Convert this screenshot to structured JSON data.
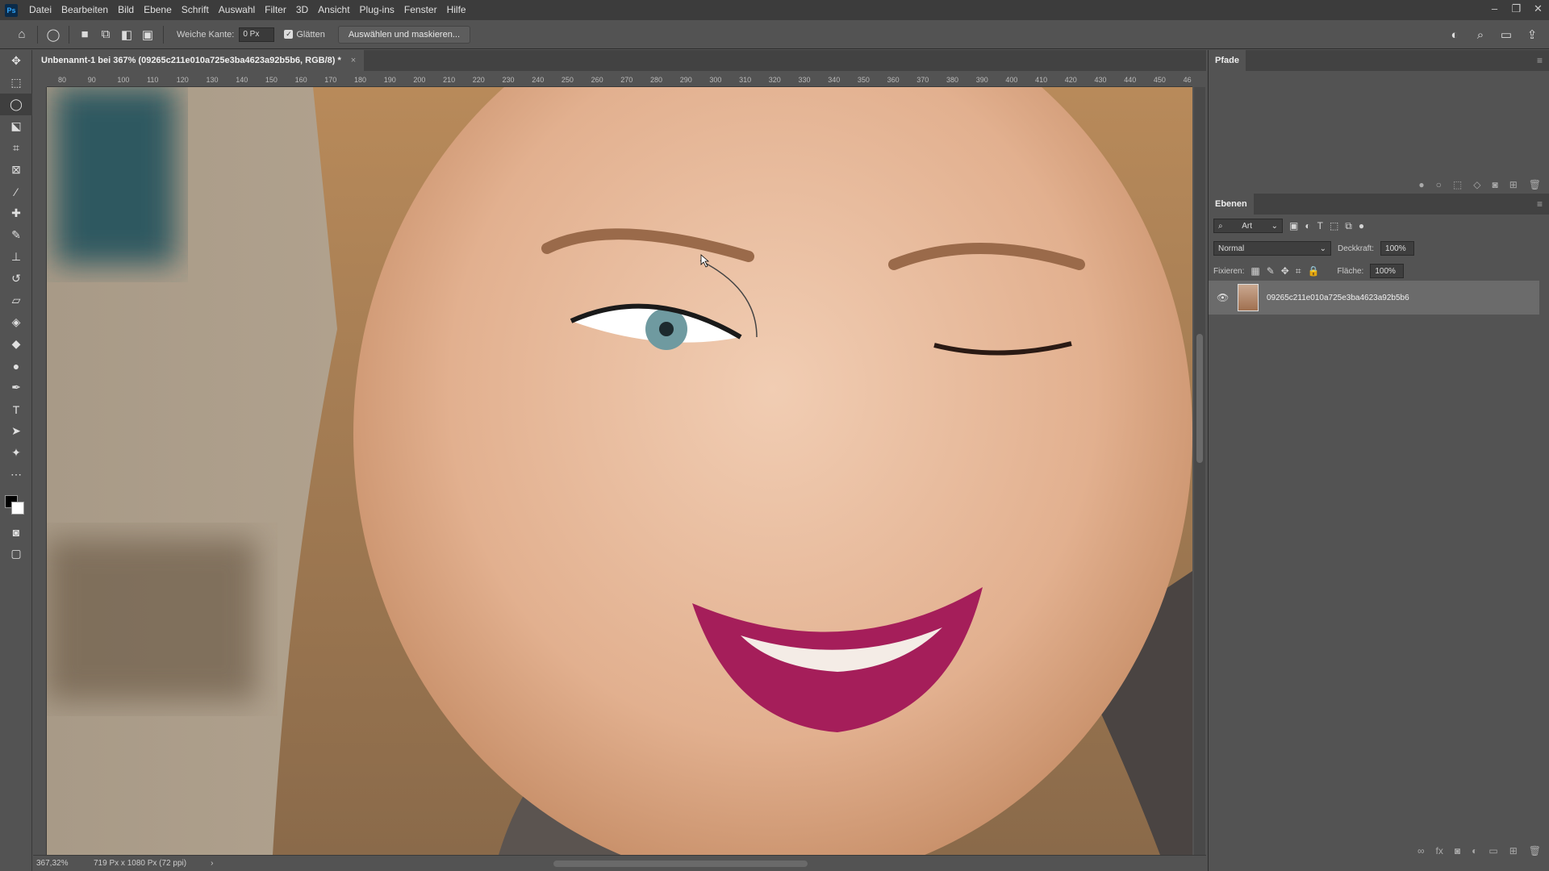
{
  "menubar": {
    "logo": "Ps",
    "items": [
      "Datei",
      "Bearbeiten",
      "Bild",
      "Ebene",
      "Schrift",
      "Auswahl",
      "Filter",
      "3D",
      "Ansicht",
      "Plug-ins",
      "Fenster",
      "Hilfe"
    ],
    "window_controls": [
      "–",
      "❐",
      "✕"
    ]
  },
  "options": {
    "feather_label": "Weiche Kante:",
    "feather_value": "0 Px",
    "antialias_label": "Glätten",
    "select_mask_button": "Auswählen und maskieren..."
  },
  "document": {
    "tab_title": "Unbenannt-1 bei 367% (09265c211e010a725e3ba4623a92b5b6, RGB/8) *",
    "close": "×",
    "ruler_ticks": [
      "80",
      "90",
      "100",
      "110",
      "120",
      "130",
      "140",
      "150",
      "160",
      "170",
      "180",
      "190",
      "200",
      "210",
      "220",
      "230",
      "240",
      "250",
      "260",
      "270",
      "280",
      "290",
      "300",
      "310",
      "320",
      "330",
      "340",
      "350",
      "360",
      "370",
      "380",
      "390",
      "400",
      "410",
      "420",
      "430",
      "440",
      "450",
      "46"
    ]
  },
  "status": {
    "zoom": "367,32%",
    "info": "719 Px x 1080 Px (72 ppi)",
    "arrow": "›"
  },
  "panels": {
    "paths_title": "Pfade",
    "layers_title": "Ebenen",
    "filter_kind": "Art",
    "blend_mode": "Normal",
    "opacity_label": "Deckkraft:",
    "opacity_value": "100%",
    "lock_label": "Fixieren:",
    "fill_label": "Fläche:",
    "fill_value": "100%",
    "layer_name": "09265c211e010a725e3ba4623a92b5b6"
  }
}
